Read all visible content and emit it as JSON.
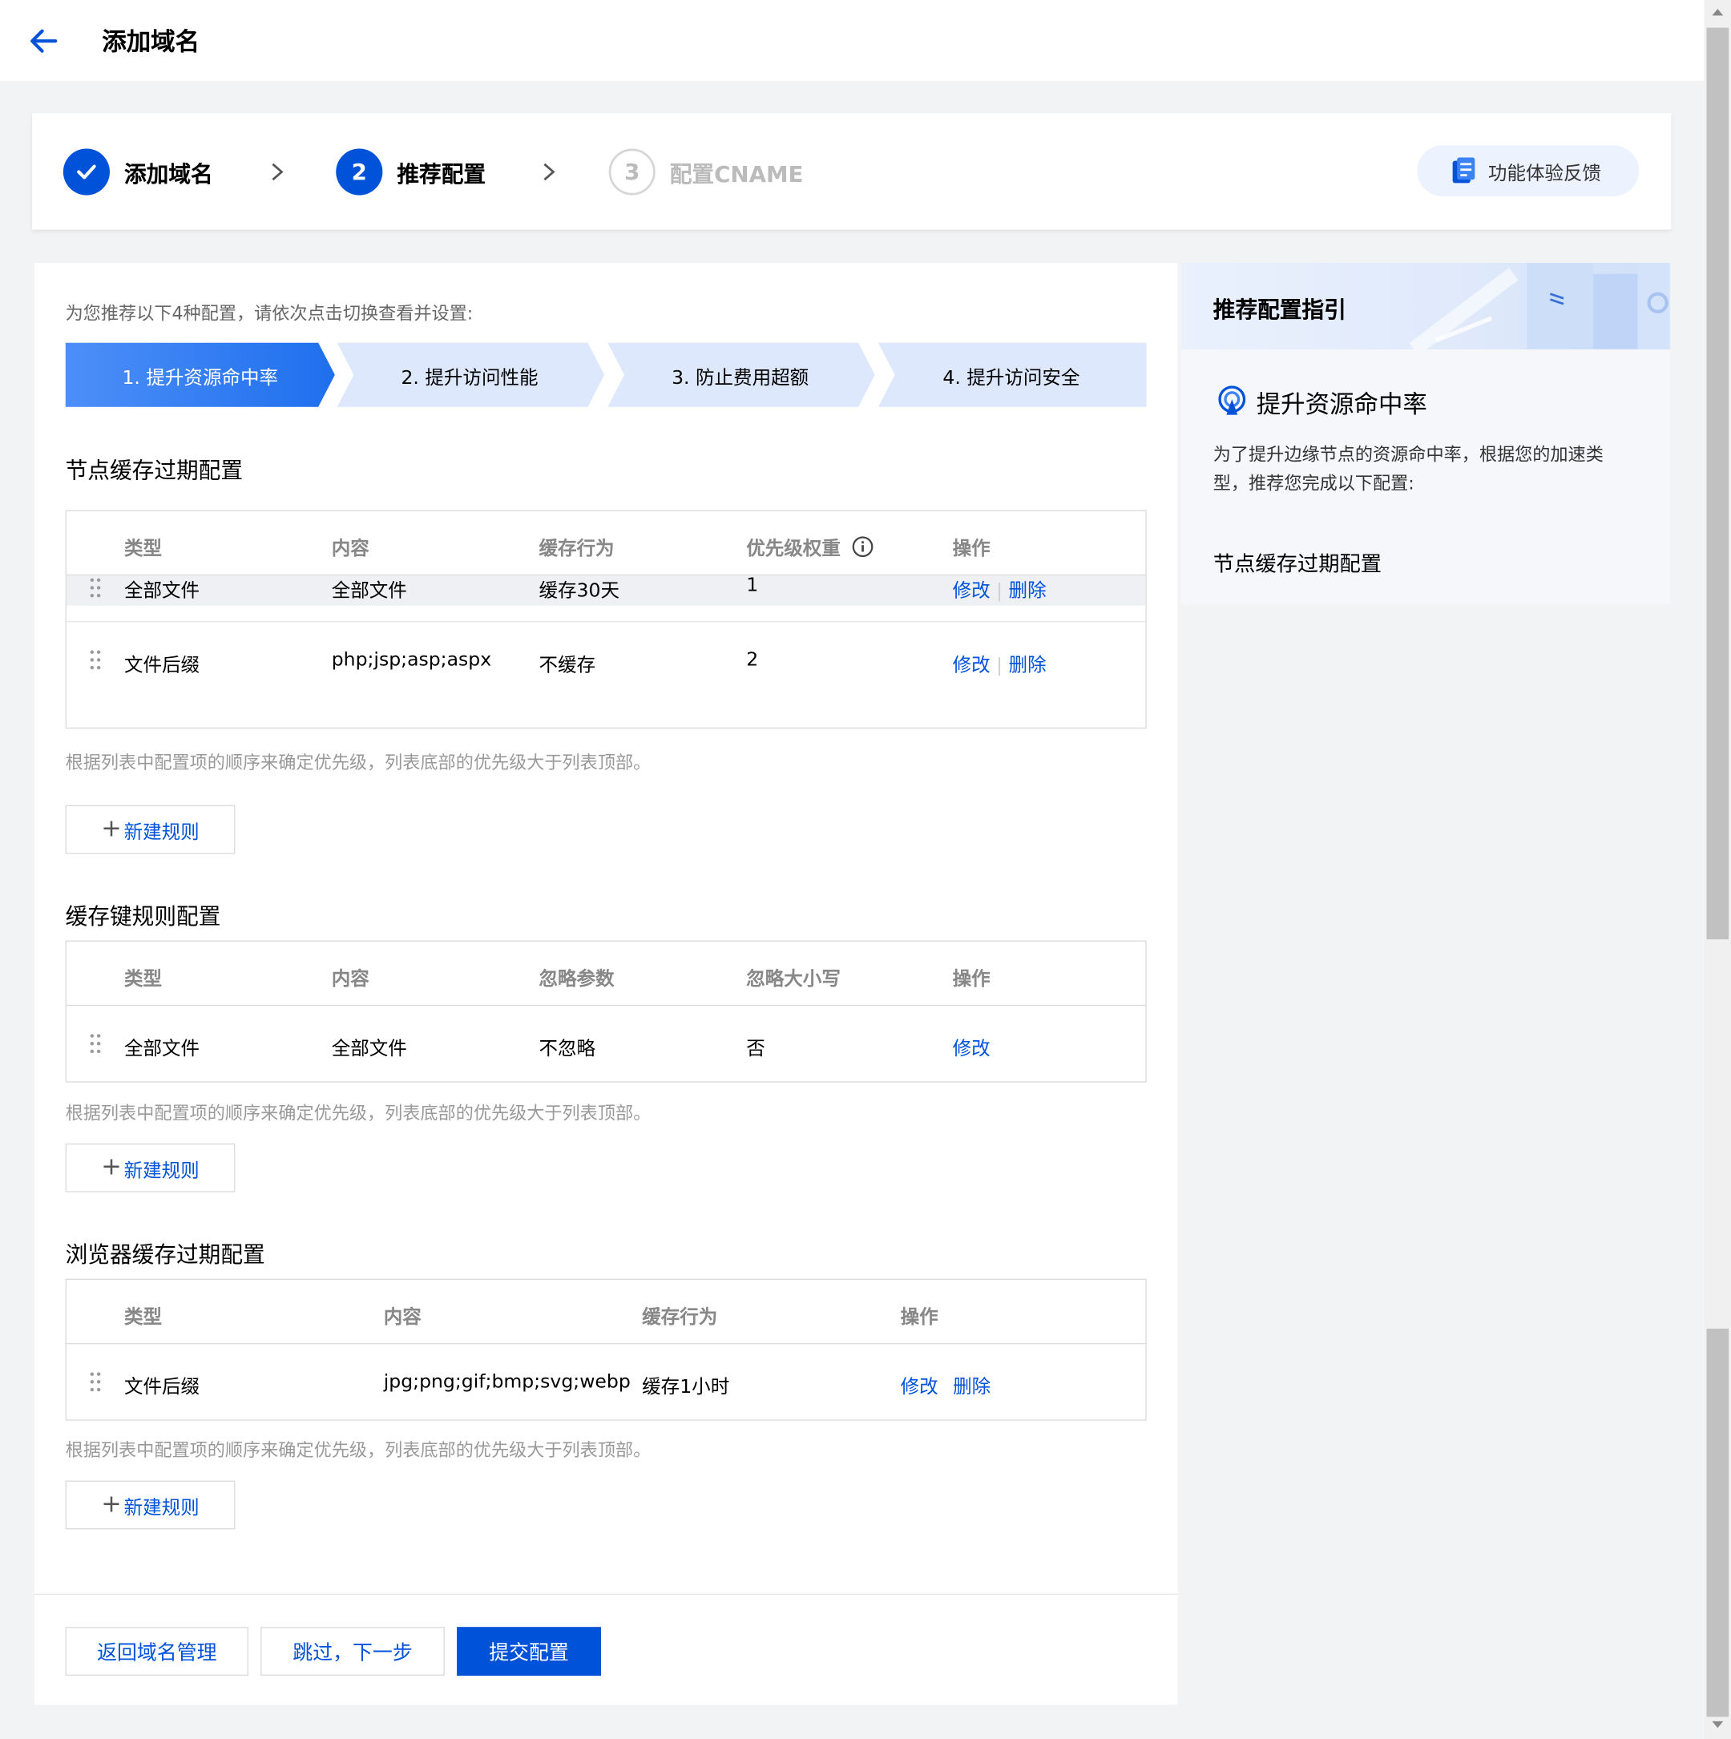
{
  "header": {
    "title": "添加域名"
  },
  "steps": [
    {
      "label": "添加域名",
      "state": "done"
    },
    {
      "number": "2",
      "label": "推荐配置",
      "state": "active"
    },
    {
      "number": "3",
      "label": "配置CNAME",
      "state": "todo"
    }
  ],
  "feedback": {
    "label": "功能体验反馈"
  },
  "intro": "为您推荐以下4种配置，请依次点击切换查看并设置:",
  "tabs": [
    "1. 提升资源命中率",
    "2. 提升访问性能",
    "3. 防止费用超额",
    "4. 提升访问安全"
  ],
  "sections": [
    {
      "title": "节点缓存过期配置",
      "columns": [
        "类型",
        "内容",
        "缓存行为",
        "优先级权重",
        "操作"
      ],
      "rows": [
        {
          "type": "全部文件",
          "content": "全部文件",
          "behavior": "缓存30天",
          "priority": "1",
          "edit": "修改",
          "delete": "删除"
        },
        {
          "type": "文件后缀",
          "content": "php;jsp;asp;aspx",
          "behavior": "不缓存",
          "priority": "2",
          "edit": "修改",
          "delete": "删除"
        }
      ],
      "tip": "根据列表中配置项的顺序来确定优先级，列表底部的优先级大于列表顶部。",
      "new_rule": "新建规则"
    },
    {
      "title": "缓存键规则配置",
      "columns": [
        "类型",
        "内容",
        "忽略参数",
        "忽略大小写",
        "操作"
      ],
      "rows": [
        {
          "type": "全部文件",
          "content": "全部文件",
          "ignore_params": "不忽略",
          "ignore_case": "否",
          "edit": "修改"
        }
      ],
      "tip": "根据列表中配置项的顺序来确定优先级，列表底部的优先级大于列表顶部。",
      "new_rule": "新建规则"
    },
    {
      "title": "浏览器缓存过期配置",
      "columns": [
        "类型",
        "内容",
        "缓存行为",
        "操作"
      ],
      "rows": [
        {
          "type": "文件后缀",
          "content": "jpg;png;gif;bmp;svg;webp",
          "behavior": "缓存1小时",
          "edit": "修改",
          "delete": "删除"
        }
      ],
      "tip": "根据列表中配置项的顺序来确定优先级，列表底部的优先级大于列表顶部。",
      "new_rule": "新建规则"
    }
  ],
  "footer": {
    "back": "返回域名管理",
    "skip": "跳过，下一步",
    "submit": "提交配置"
  },
  "guide": {
    "title": "推荐配置指引",
    "subtitle": "提升资源命中率",
    "text": "为了提升边缘节点的资源命中率，根据您的加速类型，推荐您完成以下配置:",
    "heading": "节点缓存过期配置"
  },
  "colors": {
    "primary": "#0052d9",
    "tab_active": "#3b82f6",
    "tab_inactive": "#dde8fc"
  }
}
